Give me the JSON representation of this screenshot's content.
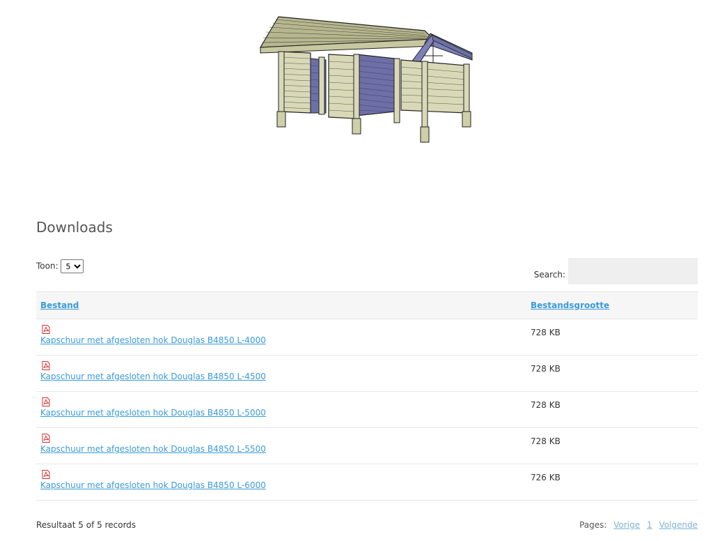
{
  "hero": {
    "alt": "carport-shed-3d-render"
  },
  "downloads": {
    "title": "Downloads",
    "length_label": "Toon:",
    "length_value": "5",
    "length_options": [
      "5"
    ],
    "search_label": "Search:",
    "search_value": "",
    "columns": {
      "file": "Bestand",
      "size": "Bestandsgrootte"
    },
    "rows": [
      {
        "name": "Kapschuur met afgesloten hok Douglas B4850 L-4000",
        "size": "728 KB",
        "icon": "pdf-icon"
      },
      {
        "name": "Kapschuur met afgesloten hok Douglas B4850 L-4500",
        "size": "728 KB",
        "icon": "pdf-icon"
      },
      {
        "name": "Kapschuur met afgesloten hok Douglas B4850 L-5000",
        "size": "728 KB",
        "icon": "pdf-icon"
      },
      {
        "name": "Kapschuur met afgesloten hok Douglas B4850 L-5500",
        "size": "728 KB",
        "icon": "pdf-icon"
      },
      {
        "name": "Kapschuur met afgesloten hok Douglas B4850 L-6000",
        "size": "726 KB",
        "icon": "pdf-icon"
      }
    ],
    "info": "Resultaat 5 of 5 records",
    "pagination": {
      "label": "Pages:",
      "prev": "Vorige",
      "page": "1",
      "next": "Volgende"
    }
  },
  "colors": {
    "link": "#3a9ad9",
    "pdf_red": "#d12f2f",
    "wall": "#d9d9b8",
    "panel_blue": "#6d6fa6"
  }
}
